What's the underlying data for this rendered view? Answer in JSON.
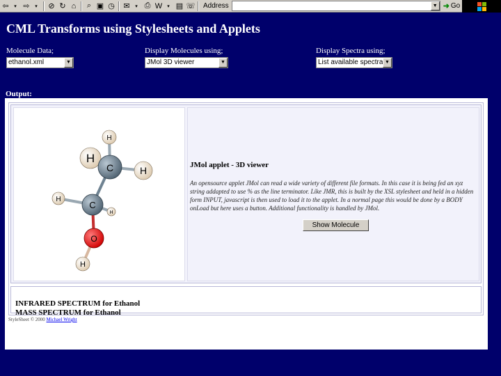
{
  "toolbar": {
    "address_label": "Address",
    "address_value": "",
    "go_label": "Go"
  },
  "page": {
    "title": "CML Transforms using Stylesheets and Applets",
    "molecule_label": "Molecule Data;",
    "molecule_value": "ethanol.xml",
    "display_label": "Display Molecules using;",
    "display_value": "JMol 3D viewer",
    "spectra_label": "Display Spectra using;",
    "spectra_value": "List available spectra",
    "output_label": "Output:"
  },
  "viewer": {
    "atoms": {
      "c1": "C",
      "c2": "C",
      "o": "O",
      "h1": "H",
      "h2": "H",
      "h3": "H",
      "h4": "H",
      "h5": "H",
      "h6": "H"
    },
    "colors": {
      "carbon": "#6f8392",
      "oxygen": "#ff0000",
      "hydrogen": "#f4e6d0"
    }
  },
  "description": {
    "title": "JMol applet - 3D viewer",
    "text": "An opensource applet JMol can read a wide variety of different file formats. In this case it is being fed an xyz string addapted to use % as the line terminator. Like JMR, this is built by the XSL stylesheet and held in a hidden form INPUT, javascript is then used to load it to the applet. In a normal page this would be done by a BODY onLoad but here uses a button. Additional functionality is handled by JMol.",
    "button_label": "Show Molecule"
  },
  "spectra": {
    "infrared": "INFRARED SPECTRUM for Ethanol",
    "mass": "MASS SPECTRUM for Ethanol"
  },
  "footer": {
    "prefix": "StyleSheet © 2000",
    "author": "Michael Wright"
  }
}
